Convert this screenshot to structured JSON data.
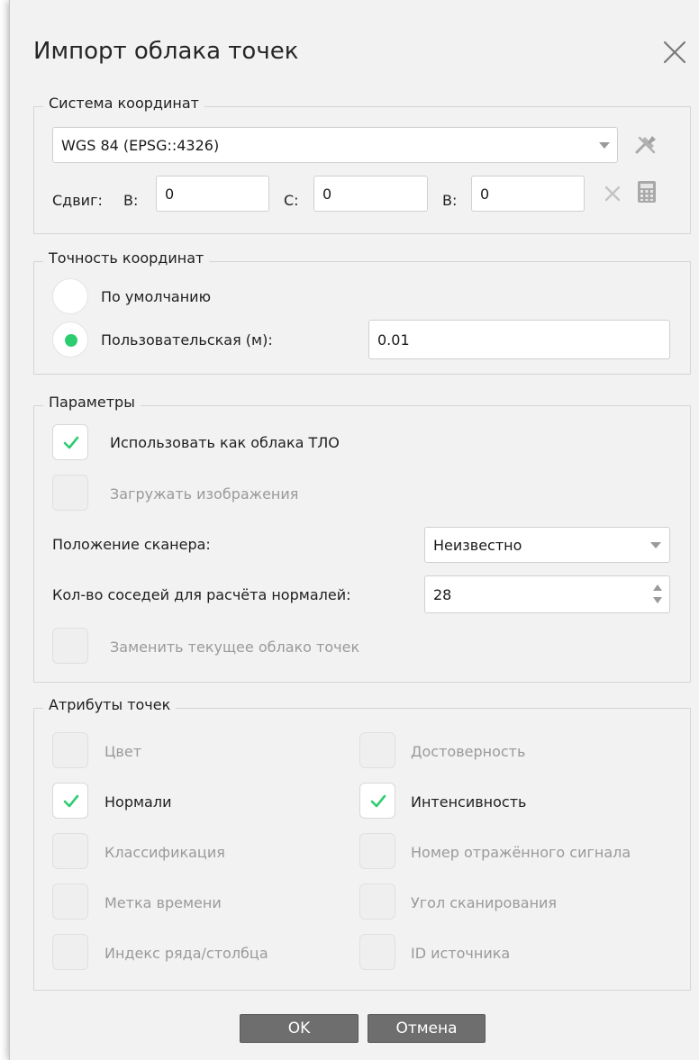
{
  "dialog": {
    "title": "Импорт облака точек",
    "close_icon": "close-icon"
  },
  "coordinate_system": {
    "legend": "Система координат",
    "crs_value": "WGS 84 (EPSG::4326)",
    "settings_icon": "tools-icon",
    "shift_label": "Сдвиг:",
    "shift_fields": [
      {
        "label": "В:",
        "value": "0"
      },
      {
        "label": "С:",
        "value": "0"
      },
      {
        "label": "В:",
        "value": "0"
      }
    ],
    "clear_icon": "clear-icon",
    "calculator_icon": "calculator-icon"
  },
  "precision": {
    "legend": "Точность координат",
    "options": [
      {
        "label": "По умолчанию",
        "selected": false
      },
      {
        "label": "Пользовательская (м):",
        "selected": true
      }
    ],
    "custom_value": "0.01"
  },
  "parameters": {
    "legend": "Параметры",
    "use_as_tlo": {
      "label": "Использовать как облака ТЛО",
      "checked": true,
      "enabled": true
    },
    "load_images": {
      "label": "Загружать изображения",
      "checked": false,
      "enabled": false
    },
    "scanner_position_label": "Положение сканера:",
    "scanner_position_value": "Неизвестно",
    "neighbors_label": "Кол-во соседей для расчёта нормалей:",
    "neighbors_value": "28",
    "replace_cloud": {
      "label": "Заменить текущее облако точек",
      "checked": false,
      "enabled": false
    }
  },
  "attributes": {
    "legend": "Атрибуты точек",
    "left": [
      {
        "label": "Цвет",
        "checked": false,
        "enabled": false
      },
      {
        "label": "Нормали",
        "checked": true,
        "enabled": true
      },
      {
        "label": "Классификация",
        "checked": false,
        "enabled": false
      },
      {
        "label": "Метка времени",
        "checked": false,
        "enabled": false
      },
      {
        "label": "Индекс ряда/столбца",
        "checked": false,
        "enabled": false
      }
    ],
    "right": [
      {
        "label": "Достоверность",
        "checked": false,
        "enabled": false
      },
      {
        "label": "Интенсивность",
        "checked": true,
        "enabled": true
      },
      {
        "label": "Номер отражённого сигнала",
        "checked": false,
        "enabled": false
      },
      {
        "label": "Угол сканирования",
        "checked": false,
        "enabled": false
      },
      {
        "label": "ID источника",
        "checked": false,
        "enabled": false
      }
    ]
  },
  "buttons": {
    "ok": "OK",
    "cancel": "Отмена"
  },
  "colors": {
    "accent": "#2ecc71",
    "button_bg": "#6e6e6e",
    "dialog_bg": "#f2f2f2"
  }
}
